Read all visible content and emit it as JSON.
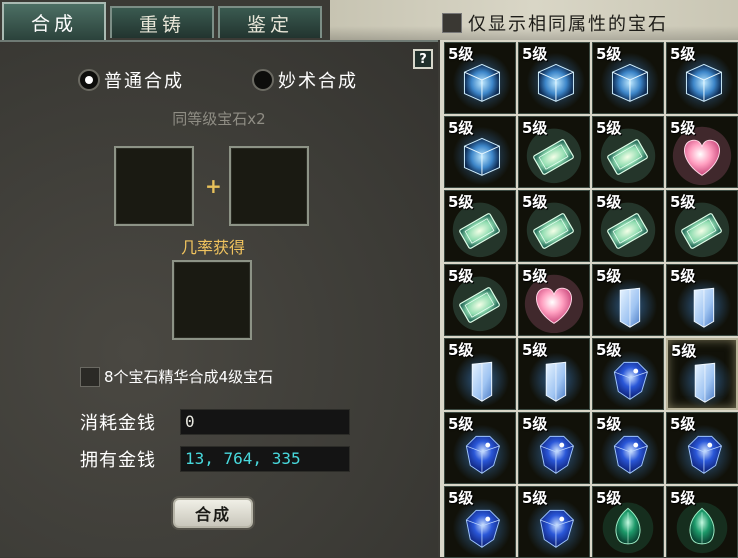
{
  "tabs": [
    {
      "label": "合成",
      "active": true
    },
    {
      "label": "重铸",
      "active": false
    },
    {
      "label": "鉴定",
      "active": false
    }
  ],
  "filter": {
    "label": "仅显示相同属性的宝石",
    "checked": false
  },
  "help_label": "?",
  "modes": {
    "normal": {
      "label": "普通合成",
      "selected": true
    },
    "skill": {
      "label": "妙术合成",
      "selected": false
    }
  },
  "hint": "同等级宝石x2",
  "plus": "+",
  "probability_label": "几率获得",
  "essence_option": {
    "label": "8个宝石精华合成4级宝石",
    "checked": false
  },
  "cost": {
    "label": "消耗金钱",
    "value": "0"
  },
  "owned": {
    "label": "拥有金钱",
    "value": "13, 764, 335"
  },
  "combine_button": "合成",
  "colors": {
    "accent_gold": "#f0c35e",
    "money_cyan": "#48d8dc"
  },
  "gems": [
    {
      "level": "5级",
      "type": "cube-icon"
    },
    {
      "level": "5级",
      "type": "cube-icon"
    },
    {
      "level": "5级",
      "type": "cube-icon"
    },
    {
      "level": "5级",
      "type": "cube-icon"
    },
    {
      "level": "5级",
      "type": "cube-icon"
    },
    {
      "level": "5级",
      "type": "green-bar-icon"
    },
    {
      "level": "5级",
      "type": "green-bar-icon"
    },
    {
      "level": "5级",
      "type": "heart-icon"
    },
    {
      "level": "5级",
      "type": "green-bar-icon"
    },
    {
      "level": "5级",
      "type": "green-bar-icon"
    },
    {
      "level": "5级",
      "type": "green-bar-icon"
    },
    {
      "level": "5级",
      "type": "green-bar-icon"
    },
    {
      "level": "5级",
      "type": "green-bar-icon"
    },
    {
      "level": "5级",
      "type": "heart-icon"
    },
    {
      "level": "5级",
      "type": "crystal-icon"
    },
    {
      "level": "5级",
      "type": "crystal-icon"
    },
    {
      "level": "5级",
      "type": "crystal-icon"
    },
    {
      "level": "5级",
      "type": "crystal-icon"
    },
    {
      "level": "5级",
      "type": "sapphire-icon"
    },
    {
      "level": "5级",
      "type": "crystal-icon",
      "selected": true
    },
    {
      "level": "5级",
      "type": "sapphire-icon"
    },
    {
      "level": "5级",
      "type": "sapphire-icon"
    },
    {
      "level": "5级",
      "type": "sapphire-icon"
    },
    {
      "level": "5级",
      "type": "sapphire-icon"
    },
    {
      "level": "5级",
      "type": "sapphire-icon"
    },
    {
      "level": "5级",
      "type": "sapphire-icon"
    },
    {
      "level": "5级",
      "type": "emerald-icon"
    },
    {
      "level": "5级",
      "type": "emerald-icon"
    }
  ]
}
